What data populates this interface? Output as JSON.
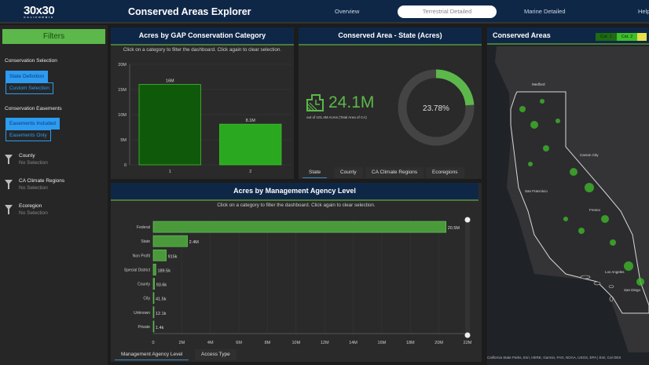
{
  "header": {
    "logo": "30x30",
    "logo_sub": "CALIFORNIA",
    "title": "Conserved Areas Explorer",
    "nav": [
      {
        "label": "Overview"
      },
      {
        "label": "Terrestrial Detailed",
        "active": true
      },
      {
        "label": "Marine Detailed"
      },
      {
        "label": "Help"
      }
    ]
  },
  "sidebar": {
    "filters_label": "Filters",
    "conservation_selection": {
      "label": "Conservation Selection",
      "options": [
        "State Definition",
        "Custom Selection"
      ],
      "selected": "State Definition"
    },
    "conservation_easements": {
      "label": "Conservation Easements",
      "options": [
        "Easements Included",
        "Easements Only"
      ],
      "selected": "Easements Included"
    },
    "filters": [
      {
        "title": "County",
        "value": "No Selection",
        "icon": "filter-icon"
      },
      {
        "title": "CA Climate Regions",
        "value": "No Selection",
        "icon": "filter-icon"
      },
      {
        "title": "Ecoregion",
        "value": "No Selection",
        "icon": "filter-icon"
      }
    ]
  },
  "gap_panel": {
    "title": "Acres by GAP Conservation Category",
    "hint": "Click on a category to filter the dashboard. Click again to clear selection."
  },
  "state_panel": {
    "title": "Conserved Area - State (Acres)",
    "value": "24.1M",
    "caption": "out of 101.4M Acres (Total Area of CA)",
    "percent_label": "23.78%",
    "percent": 23.78,
    "tabs": [
      "State",
      "County",
      "CA Climate Regions",
      "Ecoregions"
    ],
    "active_tab": "State"
  },
  "agency_panel": {
    "title": "Acres by Management Agency Level",
    "hint": "Click on a category to filter the dashboard. Click again to clear selection.",
    "tabs": [
      "Management Agency Level",
      "Access Type"
    ],
    "active_tab": "Management Agency Level"
  },
  "map_panel": {
    "title": "Conserved Areas",
    "legend": [
      {
        "label": "Cat. 1",
        "color": "#1e6b14"
      },
      {
        "label": "Cat. 2",
        "color": "#3fbf2a"
      },
      {
        "label": "",
        "color": "#e8e04a"
      }
    ],
    "places": [
      "Medford",
      "Carson City",
      "San Francisco",
      "Fresno",
      "Los Angeles",
      "San Diego"
    ],
    "attribution": "California State Parks, Esri, HERE, Garmin, FAO, NOAA, USGS, EPA | Esri, Cal OES"
  },
  "colors": {
    "accent": "#5cb84a",
    "navy": "#0f2747",
    "button_blue": "#2d9bf0"
  },
  "chart_data": [
    {
      "type": "bar",
      "title": "Acres by GAP Conservation Category",
      "categories": [
        "1",
        "2"
      ],
      "values": [
        16000000,
        8100000
      ],
      "data_labels": [
        "16M",
        "8.1M"
      ],
      "colors": [
        "#0f5a0a",
        "#2aa81f"
      ],
      "ylim": [
        0,
        20000000
      ],
      "yticks": [
        "0",
        "5M",
        "10M",
        "15M",
        "20M"
      ],
      "grid": true
    },
    {
      "type": "pie",
      "title": "Conserved Area - State (Acres)",
      "values": [
        23.78,
        76.22
      ],
      "colors": [
        "#5cb84a",
        "#444444"
      ],
      "center_label": "23.78%"
    },
    {
      "type": "bar",
      "orientation": "horizontal",
      "title": "Acres by Management Agency Level",
      "categories": [
        "Federal",
        "State",
        "Non Profit",
        "Special District",
        "County",
        "City",
        "Unknown",
        "Private"
      ],
      "values": [
        20500000,
        2400000,
        915000,
        189500,
        93600,
        41500,
        12100,
        1400
      ],
      "data_labels": [
        "20.5M",
        "2.4M",
        "915k",
        "189.5k",
        "93.6k",
        "41.5k",
        "12.1k",
        "1.4k"
      ],
      "xlim": [
        0,
        22000000
      ],
      "xticks": [
        "0",
        "2M",
        "4M",
        "6M",
        "8M",
        "10M",
        "12M",
        "14M",
        "16M",
        "18M",
        "20M",
        "22M"
      ],
      "grid": true,
      "color": "#4a9a3c"
    }
  ]
}
